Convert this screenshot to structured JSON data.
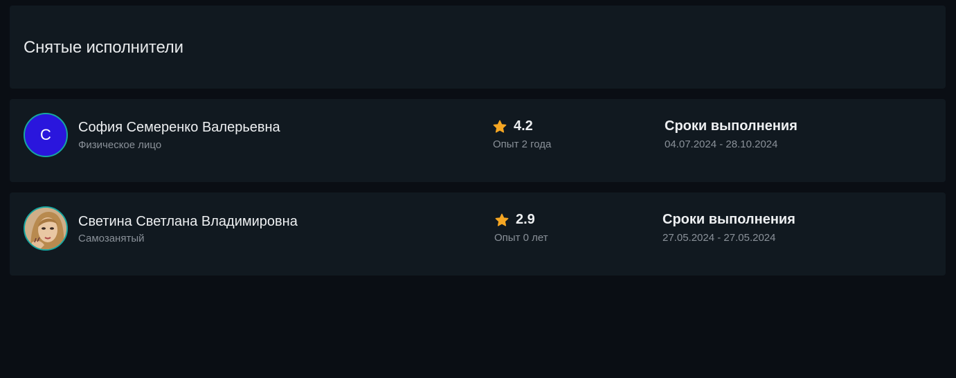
{
  "header": {
    "title": "Снятые исполнители"
  },
  "performers": [
    {
      "avatar_letter": "С",
      "name": "София Семеренко Валерьевна",
      "type": "Физическое лицо",
      "rating": "4.2",
      "experience": "Опыт 2 года",
      "terms_label": "Сроки выполнения",
      "terms_dates": "04.07.2024 - 28.10.2024"
    },
    {
      "avatar_letter": "",
      "name": "Светина Светлана Владимировна",
      "type": "Самозанятый",
      "rating": "2.9",
      "experience": "Опыт 0 лет",
      "terms_label": "Сроки выполнения",
      "terms_dates": "27.05.2024 - 27.05.2024"
    }
  ],
  "colors": {
    "background": "#0a0e14",
    "card": "#111920",
    "star": "#f5a623",
    "avatar_letter_bg": "#2a16dd",
    "avatar_border": "#17a6a0"
  }
}
